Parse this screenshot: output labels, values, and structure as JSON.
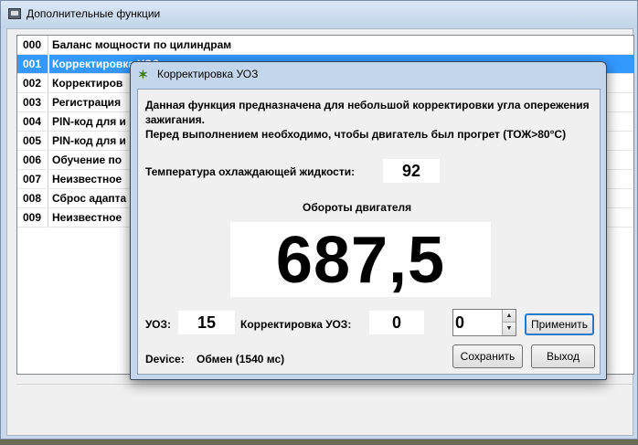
{
  "main_window": {
    "title": "Дополнительные функции",
    "functions": [
      {
        "code": "000",
        "name": "Баланс мощности по цилиндрам"
      },
      {
        "code": "001",
        "name": "Корректировка УОЗ"
      },
      {
        "code": "002",
        "name": "Корректиров"
      },
      {
        "code": "003",
        "name": "Регистрация"
      },
      {
        "code": "004",
        "name": "PIN-код для и"
      },
      {
        "code": "005",
        "name": "PIN-код для и"
      },
      {
        "code": "006",
        "name": "Обучение по"
      },
      {
        "code": "007",
        "name": "Неизвестное"
      },
      {
        "code": "008",
        "name": "Сброс адапта"
      },
      {
        "code": "009",
        "name": "Неизвестное"
      }
    ],
    "selected_index": 1
  },
  "dialog": {
    "title": "Корректировка УОЗ",
    "description_line1": "Данная функция предназначена для небольшой корректировки угла опережения зажигания.",
    "description_line2": "Перед выполнением необходимо, чтобы двигатель был прогрет (ТОЖ>80°С)",
    "coolant_temp_label": "Температура охлаждающей жидкости:",
    "coolant_temp_value": "92",
    "rpm_label": "Обороты двигателя",
    "rpm_value": "687,5",
    "uoz_label": "УОЗ:",
    "uoz_value": "15",
    "correction_label": "Корректировка УОЗ:",
    "correction_value": "0",
    "correction_input_value": "0",
    "apply_button": "Применить",
    "save_button": "Сохранить",
    "exit_button": "Выход",
    "device_label": "Device:",
    "device_status": "Обмен (1540 мс)"
  }
}
